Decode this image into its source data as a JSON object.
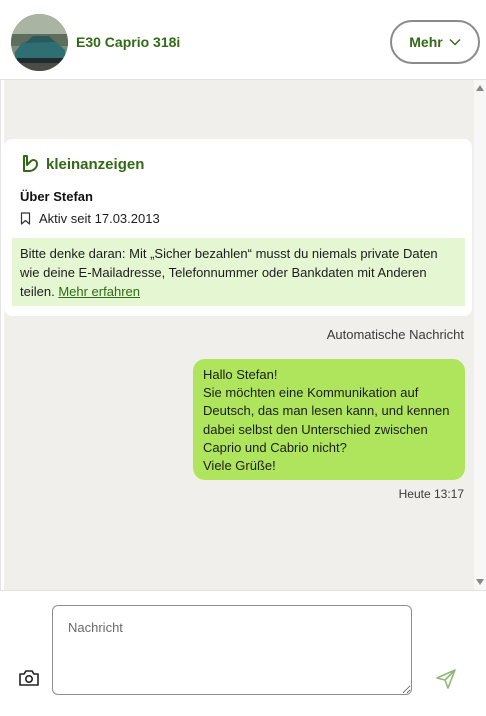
{
  "header": {
    "title": "E30 Caprio 318i",
    "more_label": "Mehr"
  },
  "info_card": {
    "brand": "kleinanzeigen",
    "about_title": "Über Stefan",
    "active_since": "Aktiv seit 17.03.2013",
    "notice_text": "Bitte denke daran: Mit „Sicher bezahlen“ musst du niemals private Daten wie deine E-Mailadresse, Telefonnummer oder Bankdaten mit Anderen teilen.",
    "notice_link": "Mehr erfahren"
  },
  "auto_message_label": "Automatische Nachricht",
  "message": {
    "text": "Hallo Stefan!\nSie möchten eine Kommunikation auf Deutsch, das man lesen kann, und kennen dabei selbst den Unterschied zwischen Caprio und Cabrio nicht?\nViele Grüße!",
    "time": "Heute 13:17"
  },
  "composer": {
    "placeholder": "Nachricht"
  },
  "colors": {
    "brand_green": "#326916",
    "bubble_green": "#aee55c",
    "notice_bg": "#e5f6d3",
    "chat_bg": "#f1efec"
  },
  "icons": [
    "chevron-down-icon",
    "kleinanzeigen-logo-icon",
    "bookmark-icon",
    "camera-icon",
    "send-icon"
  ]
}
